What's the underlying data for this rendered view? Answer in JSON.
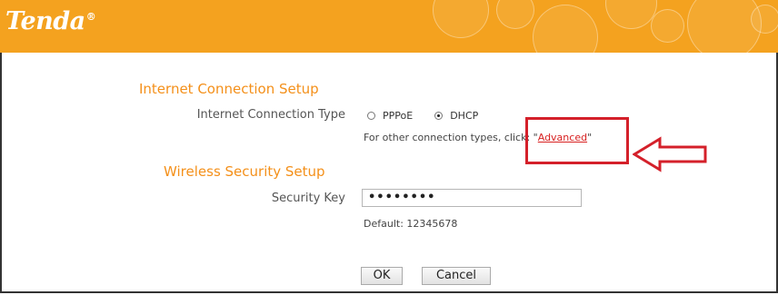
{
  "header": {
    "logo": "Tenda",
    "logo_mark": "®"
  },
  "internet": {
    "title": "Internet Connection Setup",
    "type_label": "Internet Connection Type",
    "options": [
      "PPPoE",
      "DHCP"
    ],
    "selected": "DHCP",
    "other_text_prefix": "For other connection types, click: \"",
    "advanced_link": "Advanced",
    "other_text_suffix": "\""
  },
  "wireless": {
    "title": "Wireless Security Setup",
    "key_label": "Security Key",
    "key_value": "••••••••",
    "default_text": "Default: 12345678"
  },
  "buttons": {
    "ok": "OK",
    "cancel": "Cancel"
  },
  "colors": {
    "header_bg": "#f4a21f",
    "section_title": "#f4901a",
    "annotation_red": "#d4202a"
  }
}
